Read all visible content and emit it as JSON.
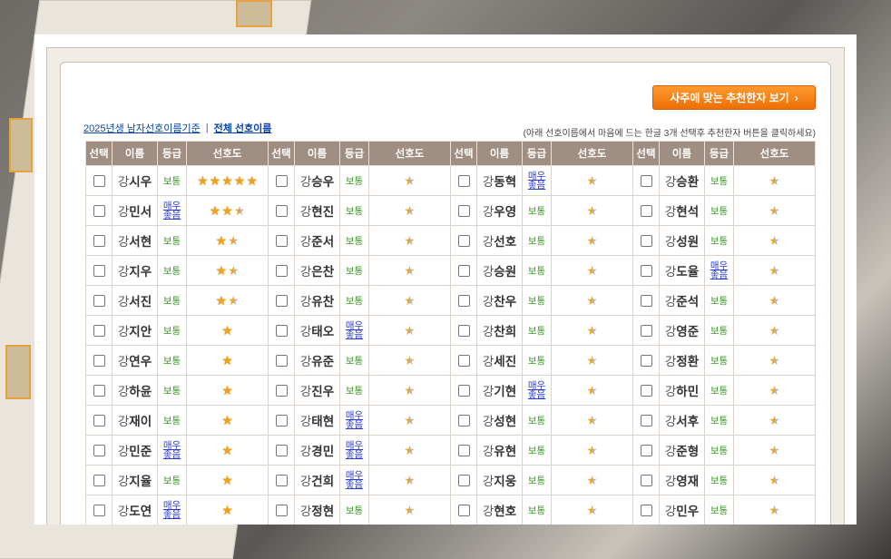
{
  "button": {
    "label": "사주에 맞는 추천한자 보기"
  },
  "links": {
    "year_basis": "2025년생 남자선호이름기준",
    "separator": "|",
    "all_names": "전체 선호이름"
  },
  "hint": "(아래 선호이름에서 마음에 드는 한글 3개 선택후 추천한자 버튼을 클릭하세요)",
  "headers": {
    "select": "선택",
    "name": "이름",
    "grade": "등급",
    "preference": "선호도"
  },
  "grade_labels": {
    "normal": "보통",
    "good_1": "매우",
    "good_2": "좋음"
  },
  "surname": "강",
  "colors": {
    "button": "#ee6f06",
    "header_bg": "#a08e82",
    "grade_normal": "#3f9a2a",
    "grade_good": "#2b3bd3",
    "star": "#f0a21a"
  },
  "columns": [
    [
      {
        "given": "시우",
        "grade": "normal",
        "stars": 5
      },
      {
        "given": "민서",
        "grade": "good",
        "stars": 2.5
      },
      {
        "given": "서현",
        "grade": "normal",
        "stars": 1.5
      },
      {
        "given": "지우",
        "grade": "normal",
        "stars": 1.5
      },
      {
        "given": "서진",
        "grade": "normal",
        "stars": 1.5
      },
      {
        "given": "지안",
        "grade": "normal",
        "stars": 1
      },
      {
        "given": "연우",
        "grade": "normal",
        "stars": 1
      },
      {
        "given": "하윤",
        "grade": "normal",
        "stars": 1
      },
      {
        "given": "재이",
        "grade": "normal",
        "stars": 1
      },
      {
        "given": "민준",
        "grade": "good",
        "stars": 1
      },
      {
        "given": "지율",
        "grade": "normal",
        "stars": 1
      },
      {
        "given": "도연",
        "grade": "good",
        "stars": 1
      }
    ],
    [
      {
        "given": "승우",
        "grade": "normal",
        "stars": 0.5
      },
      {
        "given": "현진",
        "grade": "normal",
        "stars": 0.5
      },
      {
        "given": "준서",
        "grade": "normal",
        "stars": 0.5
      },
      {
        "given": "은찬",
        "grade": "normal",
        "stars": 0.5
      },
      {
        "given": "유찬",
        "grade": "normal",
        "stars": 0.5
      },
      {
        "given": "태오",
        "grade": "good",
        "stars": 0.5
      },
      {
        "given": "유준",
        "grade": "normal",
        "stars": 0.5
      },
      {
        "given": "진우",
        "grade": "normal",
        "stars": 0.5
      },
      {
        "given": "태현",
        "grade": "good",
        "stars": 0.5
      },
      {
        "given": "경민",
        "grade": "good",
        "stars": 0.5
      },
      {
        "given": "건희",
        "grade": "good",
        "stars": 0.5
      },
      {
        "given": "정현",
        "grade": "normal",
        "stars": 0.5
      }
    ],
    [
      {
        "given": "동혁",
        "grade": "good",
        "stars": 0.5
      },
      {
        "given": "우영",
        "grade": "normal",
        "stars": 0.5
      },
      {
        "given": "선호",
        "grade": "normal",
        "stars": 0.5
      },
      {
        "given": "승원",
        "grade": "normal",
        "stars": 0.5
      },
      {
        "given": "찬우",
        "grade": "normal",
        "stars": 0.5
      },
      {
        "given": "찬희",
        "grade": "normal",
        "stars": 0.5
      },
      {
        "given": "세진",
        "grade": "normal",
        "stars": 0.5
      },
      {
        "given": "기현",
        "grade": "good",
        "stars": 0.5
      },
      {
        "given": "성현",
        "grade": "normal",
        "stars": 0.5
      },
      {
        "given": "유현",
        "grade": "normal",
        "stars": 0.5
      },
      {
        "given": "지웅",
        "grade": "normal",
        "stars": 0.5
      },
      {
        "given": "현호",
        "grade": "normal",
        "stars": 0.5
      }
    ],
    [
      {
        "given": "승환",
        "grade": "normal",
        "stars": 0.5
      },
      {
        "given": "현석",
        "grade": "normal",
        "stars": 0.5
      },
      {
        "given": "성원",
        "grade": "normal",
        "stars": 0.5
      },
      {
        "given": "도율",
        "grade": "good",
        "stars": 0.5
      },
      {
        "given": "준석",
        "grade": "normal",
        "stars": 0.5
      },
      {
        "given": "영준",
        "grade": "normal",
        "stars": 0.5
      },
      {
        "given": "정환",
        "grade": "normal",
        "stars": 0.5
      },
      {
        "given": "하민",
        "grade": "normal",
        "stars": 0.5
      },
      {
        "given": "서후",
        "grade": "normal",
        "stars": 0.5
      },
      {
        "given": "준형",
        "grade": "normal",
        "stars": 0.5
      },
      {
        "given": "영재",
        "grade": "normal",
        "stars": 0.5
      },
      {
        "given": "민우",
        "grade": "normal",
        "stars": 0.5
      }
    ]
  ]
}
